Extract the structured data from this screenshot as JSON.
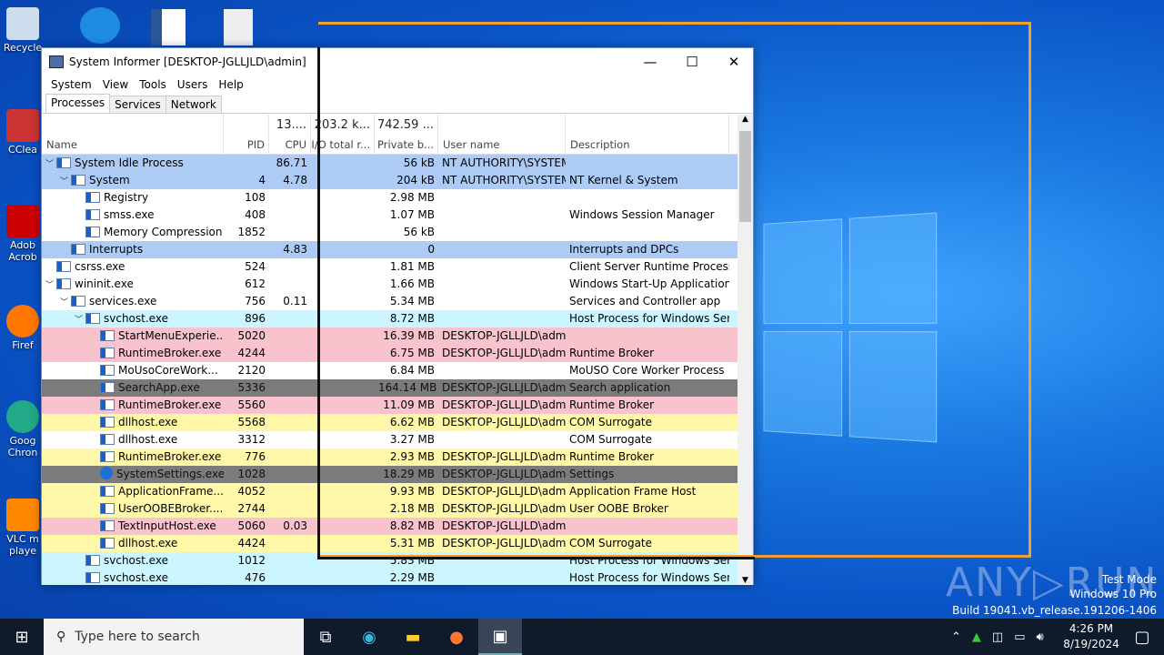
{
  "desktop": {
    "icons": [
      "Recycle",
      "CClea",
      "Adob Acrob",
      "Firef",
      "Goog Chron",
      "VLC m playe"
    ]
  },
  "window": {
    "title": "System Informer [DESKTOP-JGLLJLD\\admin]",
    "minimize": "—",
    "maximize": "☐",
    "close": "✕",
    "menu": [
      "System",
      "View",
      "Tools",
      "Users",
      "Help"
    ],
    "tabs": [
      "Processes",
      "Services",
      "Network"
    ],
    "columns": [
      {
        "label": "Name",
        "total": ""
      },
      {
        "label": "PID",
        "total": ""
      },
      {
        "label": "CPU",
        "total": "13...."
      },
      {
        "label": "I/O total r...",
        "total": "203.2 k..."
      },
      {
        "label": "Private b...",
        "total": "742.59 ..."
      },
      {
        "label": "User name",
        "total": ""
      },
      {
        "label": "Description",
        "total": ""
      }
    ],
    "rows": [
      {
        "lvl": 0,
        "exp": "v",
        "name": "System Idle Process",
        "pid": "",
        "cpu": "86.71",
        "io": "",
        "priv": "56 kB",
        "user": "NT AUTHORITY\\SYSTEM",
        "desc": "",
        "color": "blue"
      },
      {
        "lvl": 1,
        "exp": "v",
        "name": "System",
        "pid": "4",
        "cpu": "4.78",
        "io": "",
        "priv": "204 kB",
        "user": "NT AUTHORITY\\SYSTEM",
        "desc": "NT Kernel & System",
        "color": "blue"
      },
      {
        "lvl": 2,
        "exp": "",
        "name": "Registry",
        "pid": "108",
        "cpu": "",
        "io": "",
        "priv": "2.98 MB",
        "user": "",
        "desc": "",
        "color": "white"
      },
      {
        "lvl": 2,
        "exp": "",
        "name": "smss.exe",
        "pid": "408",
        "cpu": "",
        "io": "",
        "priv": "1.07 MB",
        "user": "",
        "desc": "Windows Session Manager",
        "color": "white"
      },
      {
        "lvl": 2,
        "exp": "",
        "name": "Memory Compression",
        "pid": "1852",
        "cpu": "",
        "io": "",
        "priv": "56 kB",
        "user": "",
        "desc": "",
        "color": "white"
      },
      {
        "lvl": 1,
        "exp": "",
        "name": "Interrupts",
        "pid": "",
        "cpu": "4.83",
        "io": "",
        "priv": "0",
        "user": "",
        "desc": "Interrupts and DPCs",
        "color": "blue"
      },
      {
        "lvl": 0,
        "exp": "",
        "name": "csrss.exe",
        "pid": "524",
        "cpu": "",
        "io": "",
        "priv": "1.81 MB",
        "user": "",
        "desc": "Client Server Runtime Process",
        "color": "white"
      },
      {
        "lvl": 0,
        "exp": "v",
        "name": "wininit.exe",
        "pid": "612",
        "cpu": "",
        "io": "",
        "priv": "1.66 MB",
        "user": "",
        "desc": "Windows Start-Up Application",
        "color": "white"
      },
      {
        "lvl": 1,
        "exp": "v",
        "name": "services.exe",
        "pid": "756",
        "cpu": "0.11",
        "io": "",
        "priv": "5.34 MB",
        "user": "",
        "desc": "Services and Controller app",
        "color": "white"
      },
      {
        "lvl": 2,
        "exp": "v",
        "name": "svchost.exe",
        "pid": "896",
        "cpu": "",
        "io": "",
        "priv": "8.72 MB",
        "user": "",
        "desc": "Host Process for Windows Ser...",
        "color": "cyan"
      },
      {
        "lvl": 3,
        "exp": "",
        "name": "StartMenuExperie...",
        "pid": "5020",
        "cpu": "",
        "io": "",
        "priv": "16.39 MB",
        "user": "DESKTOP-JGLLJLD\\admi",
        "desc": "",
        "color": "pink"
      },
      {
        "lvl": 3,
        "exp": "",
        "name": "RuntimeBroker.exe",
        "pid": "4244",
        "cpu": "",
        "io": "",
        "priv": "6.75 MB",
        "user": "DESKTOP-JGLLJLD\\admi",
        "desc": "Runtime Broker",
        "color": "pink"
      },
      {
        "lvl": 3,
        "exp": "",
        "name": "MoUsoCoreWork...",
        "pid": "2120",
        "cpu": "",
        "io": "",
        "priv": "6.84 MB",
        "user": "",
        "desc": "MoUSO Core Worker Process",
        "color": "white"
      },
      {
        "lvl": 3,
        "exp": "",
        "name": "SearchApp.exe",
        "pid": "5336",
        "cpu": "",
        "io": "",
        "priv": "164.14 MB",
        "user": "DESKTOP-JGLLJLD\\admi",
        "desc": "Search application",
        "color": "dark"
      },
      {
        "lvl": 3,
        "exp": "",
        "name": "RuntimeBroker.exe",
        "pid": "5560",
        "cpu": "",
        "io": "",
        "priv": "11.09 MB",
        "user": "DESKTOP-JGLLJLD\\admi",
        "desc": "Runtime Broker",
        "color": "pink"
      },
      {
        "lvl": 3,
        "exp": "",
        "name": "dllhost.exe",
        "pid": "5568",
        "cpu": "",
        "io": "",
        "priv": "6.62 MB",
        "user": "DESKTOP-JGLLJLD\\admi",
        "desc": "COM Surrogate",
        "color": "yellow"
      },
      {
        "lvl": 3,
        "exp": "",
        "name": "dllhost.exe",
        "pid": "3312",
        "cpu": "",
        "io": "",
        "priv": "3.27 MB",
        "user": "",
        "desc": "COM Surrogate",
        "color": "white"
      },
      {
        "lvl": 3,
        "exp": "",
        "name": "RuntimeBroker.exe",
        "pid": "776",
        "cpu": "",
        "io": "",
        "priv": "2.93 MB",
        "user": "DESKTOP-JGLLJLD\\admi",
        "desc": "Runtime Broker",
        "color": "yellow"
      },
      {
        "lvl": 3,
        "exp": "",
        "name": "SystemSettings.exe",
        "pid": "1028",
        "cpu": "",
        "io": "",
        "priv": "18.29 MB",
        "user": "DESKTOP-JGLLJLD\\admi",
        "desc": "Settings",
        "color": "dark",
        "icon": "gear"
      },
      {
        "lvl": 3,
        "exp": "",
        "name": "ApplicationFrame...",
        "pid": "4052",
        "cpu": "",
        "io": "",
        "priv": "9.93 MB",
        "user": "DESKTOP-JGLLJLD\\admi",
        "desc": "Application Frame Host",
        "color": "yellow"
      },
      {
        "lvl": 3,
        "exp": "",
        "name": "UserOOBEBroker....",
        "pid": "2744",
        "cpu": "",
        "io": "",
        "priv": "2.18 MB",
        "user": "DESKTOP-JGLLJLD\\admi",
        "desc": "User OOBE Broker",
        "color": "yellow"
      },
      {
        "lvl": 3,
        "exp": "",
        "name": "TextInputHost.exe",
        "pid": "5060",
        "cpu": "0.03",
        "io": "",
        "priv": "8.82 MB",
        "user": "DESKTOP-JGLLJLD\\admi",
        "desc": "",
        "color": "pink"
      },
      {
        "lvl": 3,
        "exp": "",
        "name": "dllhost.exe",
        "pid": "4424",
        "cpu": "",
        "io": "",
        "priv": "5.31 MB",
        "user": "DESKTOP-JGLLJLD\\admi",
        "desc": "COM Surrogate",
        "color": "yellow"
      },
      {
        "lvl": 2,
        "exp": "",
        "name": "svchost.exe",
        "pid": "1012",
        "cpu": "",
        "io": "",
        "priv": "5.83 MB",
        "user": "",
        "desc": "Host Process for Windows Ser...",
        "color": "cyan"
      },
      {
        "lvl": 2,
        "exp": "",
        "name": "svchost.exe",
        "pid": "476",
        "cpu": "",
        "io": "",
        "priv": "2.29 MB",
        "user": "",
        "desc": "Host Process for Windows Ser...",
        "color": "cyan"
      }
    ]
  },
  "watermark": {
    "brand": "ANY RUN",
    "line1": "Test Mode",
    "line2": "Windows 10 Pro",
    "line3": "Build 19041.vb_release.191206-1406"
  },
  "taskbar": {
    "search_placeholder": "Type here to search",
    "time": "4:26 PM",
    "date": "8/19/2024"
  }
}
